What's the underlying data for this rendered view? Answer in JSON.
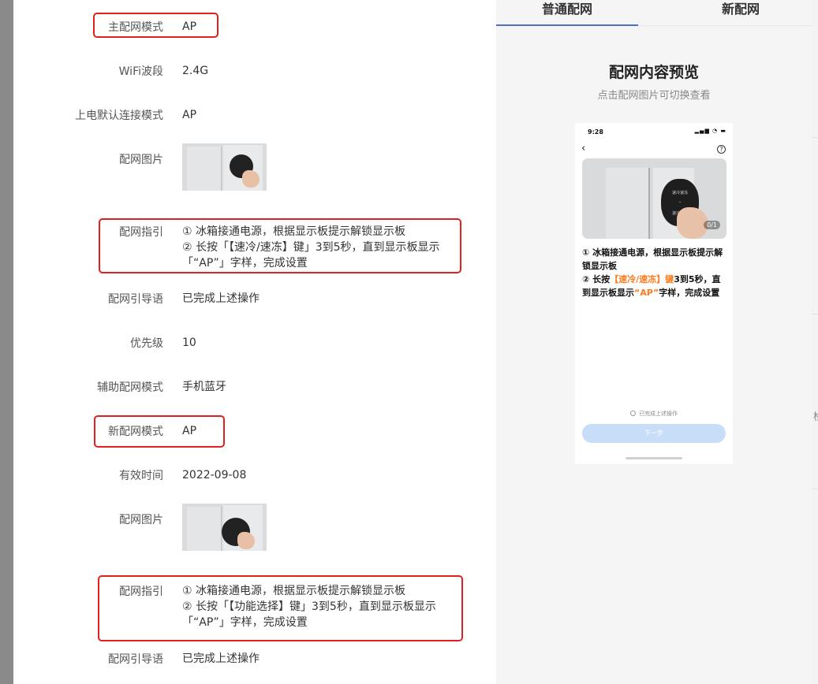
{
  "left_rows": [
    {
      "label": "主配网模式",
      "value": "AP"
    },
    {
      "label": "WiFi波段",
      "value": "2.4G"
    },
    {
      "label": "上电默认连接模式",
      "value": "AP"
    },
    {
      "label": "配网图片",
      "value": ""
    },
    {
      "label": "配网指引",
      "value": "① 冰箱接通电源，根据显示板提示解锁显示板\n② 长按「【速冷/速冻】键」3到5秒，直到显示板显示「“AP”」字样，完成设置"
    },
    {
      "label": "配网引导语",
      "value": "已完成上述操作"
    },
    {
      "label": "优先级",
      "value": "10"
    },
    {
      "label": "辅助配网模式",
      "value": "手机蓝牙"
    },
    {
      "label": "新配网模式",
      "value": "AP"
    },
    {
      "label": "有效时间",
      "value": "2022-09-08"
    },
    {
      "label": "配网图片",
      "value": ""
    },
    {
      "label": "配网指引",
      "value": "① 冰箱接通电源，根据显示板提示解锁显示板\n② 长按「【功能选择】键」3到5秒，直到显示板显示「“AP”」字样，完成设置"
    },
    {
      "label": "配网引导语",
      "value": "已完成上述操作"
    }
  ],
  "tabs": [
    {
      "label": "普通配网",
      "active": true
    },
    {
      "label": "新配网",
      "active": false
    }
  ],
  "preview": {
    "title": "配网内容预览",
    "subtitle": "点击配网图片可切换查看",
    "phone": {
      "time": "9:28",
      "status_icons": "signal-wifi-battery",
      "image_counter": "0/1",
      "panel_text_top": "速冷速冻",
      "panel_text_bottom": "速冷速冻",
      "line1": "① 冰箱接通电源，根据显示板提示解锁显示板",
      "line2_pre": "② 长按",
      "line2_key": "【速冷/速冻】键",
      "line2_mid": "3到5秒，直到显示板显示",
      "line2_ap": "“AP”",
      "line2_post": "字样，完成设置",
      "radio_label": "已完成上述操作",
      "next_button": "下一步"
    }
  },
  "colors": {
    "highlight": "#e02020",
    "tab_underline": "#4a6cd4",
    "orange": "#ff7a1a",
    "button_disabled": "#c8ddf7"
  },
  "backdrop_glyph": "检"
}
